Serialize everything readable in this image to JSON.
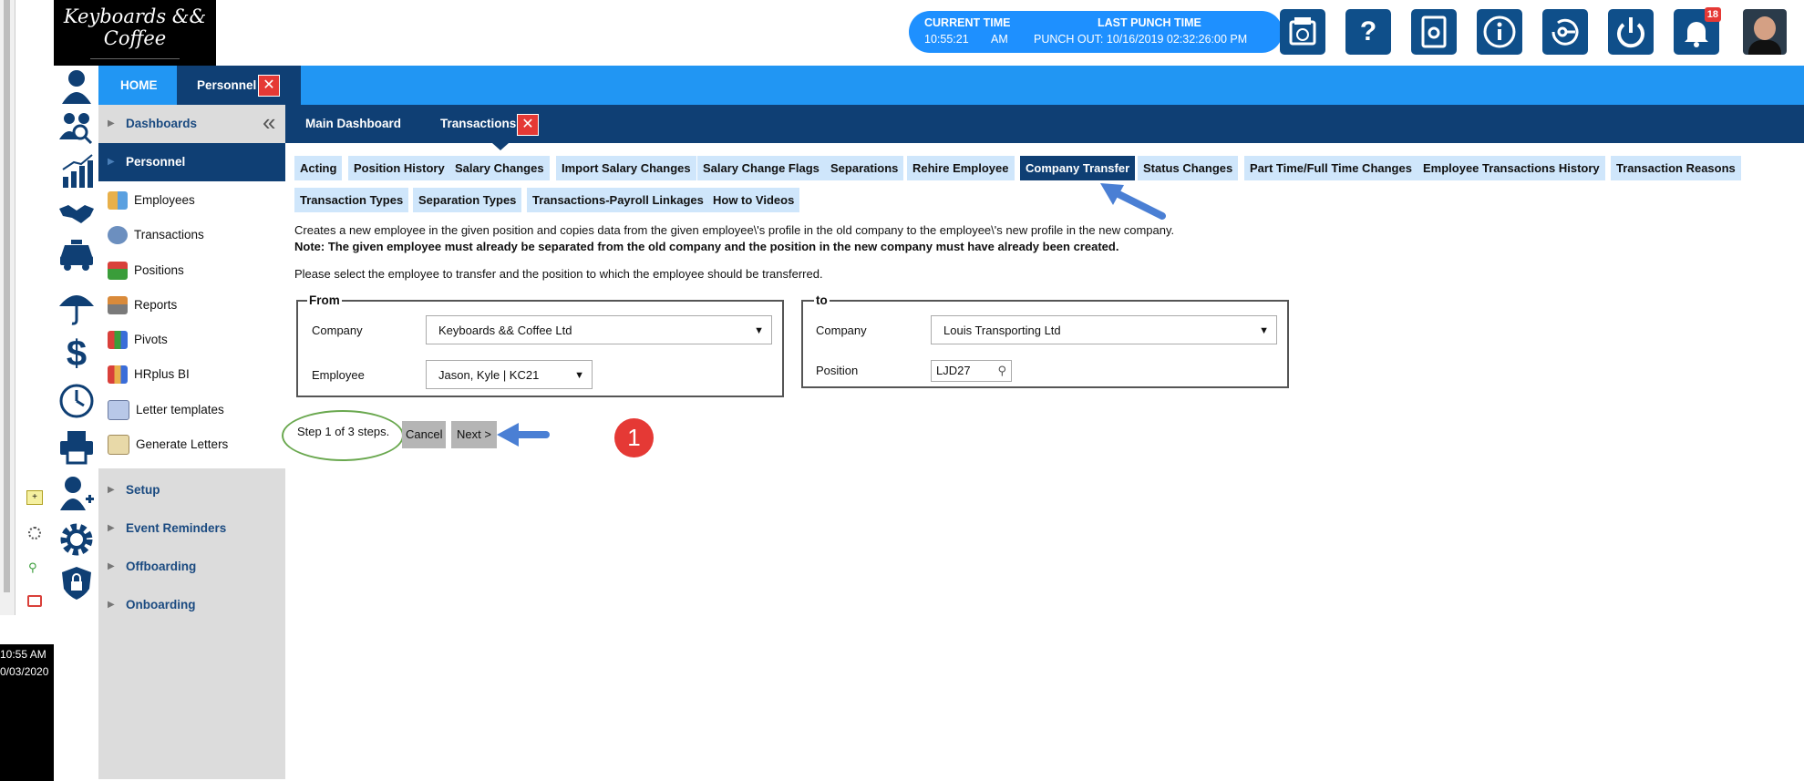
{
  "app": {
    "logo_title": "Keyboards && Coffee",
    "logo_tagline": "⌨ + ☕ = </>"
  },
  "os": {
    "clock_time": "10:55 AM",
    "clock_date": "0/03/2020"
  },
  "header": {
    "current_time_label": "CURRENT TIME",
    "current_time_value": "10:55:21",
    "current_time_ampm": "AM",
    "last_punch_label": "LAST PUNCH TIME",
    "last_punch_value": "PUNCH OUT: 10/16/2019 02:32:26:00 PM",
    "notification_count": "18",
    "icons": [
      "timeclock-icon",
      "help-icon",
      "settings-book-icon",
      "info-icon",
      "password-icon",
      "power-icon",
      "bell-icon"
    ]
  },
  "nav": {
    "home": "HOME",
    "personnel": "Personnel",
    "close_glyph": "✕"
  },
  "sidebar": {
    "collapse_glyph": "«",
    "dashboards": "Dashboards",
    "personnel": "Personnel",
    "items": [
      "Employees",
      "Transactions",
      "Positions",
      "Reports",
      "Pivots",
      "HRplus BI",
      "Letter templates",
      "Generate Letters"
    ],
    "setup": "Setup",
    "event_reminders": "Event Reminders",
    "offboarding": "Offboarding",
    "onboarding": "Onboarding"
  },
  "subnav": {
    "main_dashboard": "Main Dashboard",
    "transactions": "Transactions"
  },
  "tabs": {
    "row1": [
      "Acting",
      "Position History",
      "Salary Changes",
      "Import Salary Changes",
      "Salary Change Flags",
      "Separations",
      "Rehire Employee",
      "Company Transfer",
      "Status Changes",
      "Part Time/Full Time Changes",
      "Employee Transactions History",
      "Transaction Reasons"
    ],
    "row2": [
      "Transaction Types",
      "Separation Types",
      "Transactions-Payroll Linkages",
      "How to Videos"
    ],
    "active": "Company Transfer"
  },
  "form": {
    "description": "Creates a new employee in the given position and copies data from the given employee\\'s profile in the old company to the employee\\'s new profile in the new company.",
    "note": "Note: The given employee must already be separated from the old company and the position in the new company must have already been created.",
    "instruction": "Please select the employee to transfer and the position to which the employee should be transferred.",
    "from_legend": "From",
    "to_legend": "to",
    "company_label": "Company",
    "employee_label": "Employee",
    "position_label": "Position",
    "from_company": "Keyboards && Coffee Ltd",
    "from_employee": "Jason, Kyle | KC21",
    "to_company": "Louis Transporting Ltd",
    "to_position": "LJD27",
    "step_text": "Step 1 of 3 steps.",
    "cancel": "Cancel",
    "next": "Next >",
    "annotation_number": "1"
  },
  "colors": {
    "primary_blue": "#2196f3",
    "dark_navy": "#0f3f74",
    "tab_light": "#cfe6fb",
    "annotation_red": "#e53935",
    "annotation_green": "#6aa84f",
    "arrow_blue": "#4a7fd4"
  }
}
